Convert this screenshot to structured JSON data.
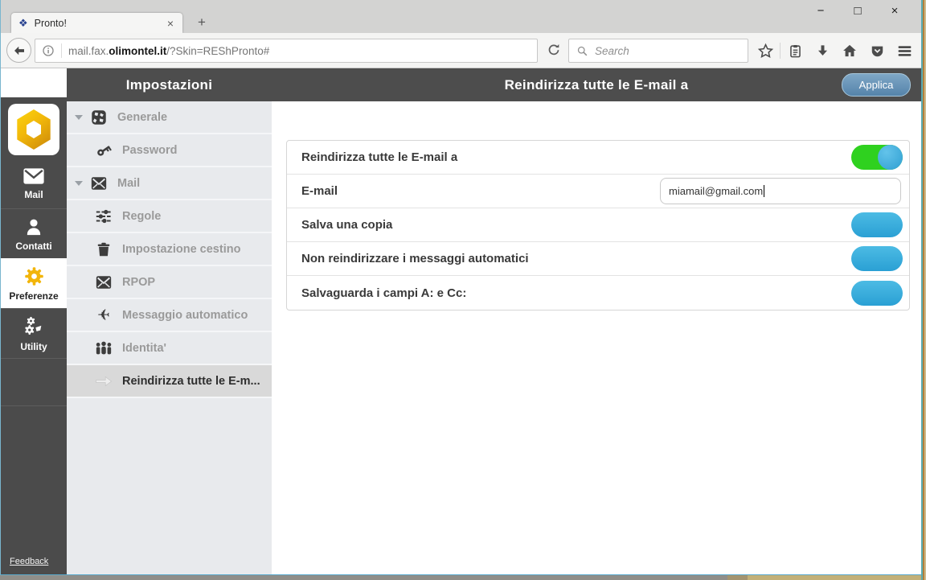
{
  "browser": {
    "tab_title": "Pronto!",
    "url_prefix": "mail.fax.",
    "url_domain": "olimontel.it",
    "url_path": "/?Skin=REShPronto#",
    "search_placeholder": "Search"
  },
  "icons": {
    "favicon": "❖",
    "minimize": "−",
    "maximize": "□",
    "close": "×",
    "tab_close": "×",
    "new_tab": "+",
    "plane": "✈"
  },
  "sidebar": {
    "items": [
      {
        "label": "Mail",
        "active": false
      },
      {
        "label": "Contatti",
        "active": false
      },
      {
        "label": "Preferenze",
        "active": true
      },
      {
        "label": "Utility",
        "active": false
      }
    ],
    "feedback": "Feedback"
  },
  "settings_menu": {
    "title": "Impostazioni",
    "items": [
      {
        "label": "Generale",
        "expandable": true,
        "selected": false
      },
      {
        "label": "Password",
        "expandable": false,
        "selected": false
      },
      {
        "label": "Mail",
        "expandable": true,
        "selected": false
      },
      {
        "label": "Regole",
        "expandable": false,
        "selected": false
      },
      {
        "label": "Impostazione cestino",
        "expandable": false,
        "selected": false
      },
      {
        "label": "RPOP",
        "expandable": false,
        "selected": false
      },
      {
        "label": "Messaggio automatico",
        "expandable": false,
        "selected": false
      },
      {
        "label": "Identita'",
        "expandable": false,
        "selected": false
      },
      {
        "label": "Reindirizza tutte le E-m...",
        "expandable": false,
        "selected": true
      }
    ]
  },
  "main": {
    "title": "Reindirizza tutte le E-mail a",
    "apply_button": "Applica",
    "rows": [
      {
        "label": "Reindirizza tutte le E-mail a",
        "control": "toggle",
        "state": "on"
      },
      {
        "label": "E-mail",
        "control": "input",
        "value": "miamail@gmail.com"
      },
      {
        "label": "Salva una copia",
        "control": "toggle",
        "state": "off"
      },
      {
        "label": "Non reindirizzare i messaggi automatici",
        "control": "toggle",
        "state": "off"
      },
      {
        "label": "Salvaguarda i campi A: e Cc:",
        "control": "toggle",
        "state": "off"
      }
    ]
  },
  "colors": {
    "accent_blue": "#35a7d7",
    "toggle_green": "#2fd11f",
    "header_gray": "#4d4d4d",
    "sidebar_gray": "#4b4b4b",
    "logo_gold": "#f1b70a",
    "apply_button_blue": "#5583aa"
  }
}
